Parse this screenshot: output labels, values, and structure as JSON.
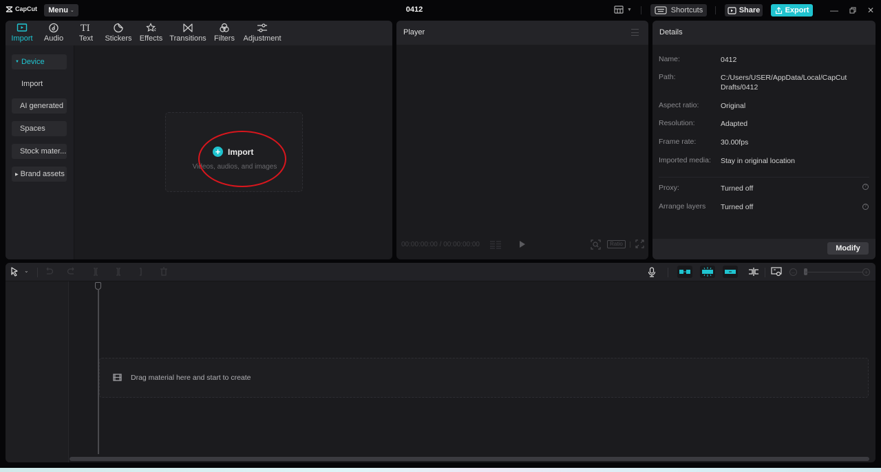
{
  "app": {
    "logo_text": "CapCut",
    "menu_label": "Menu",
    "project_title": "0412"
  },
  "titlebar": {
    "layout_icon": "layout-icon",
    "shortcuts_label": "Shortcuts",
    "share_label": "Share",
    "export_label": "Export",
    "accent_color": "#1fc3cf"
  },
  "media_tabs": [
    {
      "label": "Import",
      "icon": "import-icon",
      "active": true
    },
    {
      "label": "Audio",
      "icon": "audio-icon",
      "active": false
    },
    {
      "label": "Text",
      "icon": "text-icon",
      "active": false
    },
    {
      "label": "Stickers",
      "icon": "stickers-icon",
      "active": false
    },
    {
      "label": "Effects",
      "icon": "effects-icon",
      "active": false
    },
    {
      "label": "Transitions",
      "icon": "transitions-icon",
      "active": false
    },
    {
      "label": "Filters",
      "icon": "filters-icon",
      "active": false
    },
    {
      "label": "Adjustment",
      "icon": "adjustment-icon",
      "active": false
    }
  ],
  "media_sidebar": [
    {
      "label": "Device",
      "expanded": true,
      "active": true
    },
    {
      "label": "Import",
      "sub": true
    },
    {
      "label": "AI generated"
    },
    {
      "label": "Spaces"
    },
    {
      "label": "Stock mater..."
    },
    {
      "label": "Brand assets",
      "collapsed": true
    }
  ],
  "import_area": {
    "title": "Import",
    "subtitle": "Videos, audios, and images"
  },
  "annotation": {
    "shape": "ellipse",
    "color": "#d9161d",
    "target": "import-button"
  },
  "player": {
    "title": "Player",
    "timecode": "00:00:00:00 / 00:00:00:00",
    "ratio_label": "Ratio"
  },
  "details": {
    "title": "Details",
    "rows": [
      {
        "label": "Name:",
        "value": "0412"
      },
      {
        "label": "Path:",
        "value": "C:/Users/USER/AppData/Local/CapCut Drafts/0412"
      },
      {
        "label": "Aspect ratio:",
        "value": "Original"
      },
      {
        "label": "Resolution:",
        "value": "Adapted"
      },
      {
        "label": "Frame rate:",
        "value": "30.00fps"
      },
      {
        "label": "Imported media:",
        "value": "Stay in original location"
      }
    ],
    "settings": [
      {
        "label": "Proxy:",
        "value": "Turned off"
      },
      {
        "label": "Arrange layers",
        "value": "Turned off"
      }
    ],
    "modify_label": "Modify"
  },
  "timeline": {
    "drop_hint": "Drag material here and start to create"
  }
}
